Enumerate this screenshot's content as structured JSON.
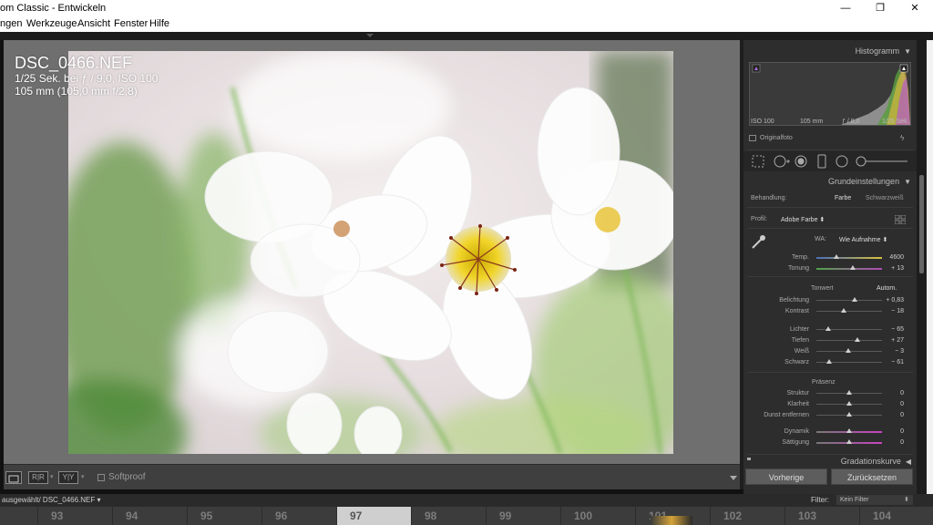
{
  "window": {
    "title": "om Classic - Entwickeln",
    "controls": {
      "minimize": "—",
      "maximize": "❐",
      "close": "✕"
    }
  },
  "menu": [
    "ngen",
    "Werkzeuge",
    "Ansicht",
    "Fenster",
    "Hilfe"
  ],
  "photo_info": {
    "filename": "DSC_0466.NEF",
    "exposure": "1/25 Sek. bei ƒ / 9,0, ISO 100",
    "lens": "105 mm (105,0 mm f/2,8)"
  },
  "toolbar": {
    "softproof_label": "Softproof",
    "xy_label": "Y|Y",
    "ab_label": "R|R"
  },
  "histogram": {
    "title": "Histogramm",
    "info": [
      "ISO 100",
      "105 mm",
      "ƒ / 9,0",
      "1/25 Sek."
    ],
    "original_label": "Originalfoto"
  },
  "basic": {
    "title": "Grundeinstellungen",
    "treatment_label": "Behandlung:",
    "treatment_options": [
      "Farbe",
      "Schwarzweiß"
    ],
    "profile_label": "Profil:",
    "profile_value": "Adobe Farbe ⬍",
    "wb_label": "WA:",
    "wb_value": "Wie Aufnahme ⬍",
    "tone_label": "Tonwert",
    "auto_label": "Autom.",
    "presence_label": "Präsenz",
    "sliders": [
      {
        "key": "temp",
        "label": "Temp.",
        "value": "4600",
        "pos": 0.3
      },
      {
        "key": "tint",
        "label": "Tonung",
        "value": "+ 13",
        "pos": 0.55
      },
      {
        "key": "exposure",
        "label": "Belichtung",
        "value": "+ 0,83",
        "pos": 0.58
      },
      {
        "key": "contrast",
        "label": "Kontrast",
        "value": "− 18",
        "pos": 0.41
      },
      {
        "key": "highlights",
        "label": "Lichter",
        "value": "− 65",
        "pos": 0.18
      },
      {
        "key": "shadows",
        "label": "Tiefen",
        "value": "+ 27",
        "pos": 0.63
      },
      {
        "key": "whites",
        "label": "Weiß",
        "value": "− 3",
        "pos": 0.48
      },
      {
        "key": "blacks",
        "label": "Schwarz",
        "value": "− 61",
        "pos": 0.19
      },
      {
        "key": "texture",
        "label": "Struktur",
        "value": "0",
        "pos": 0.5
      },
      {
        "key": "clarity",
        "label": "Klarheit",
        "value": "0",
        "pos": 0.5
      },
      {
        "key": "dehaze",
        "label": "Dunst entfernen",
        "value": "0",
        "pos": 0.5
      },
      {
        "key": "vibrance",
        "label": "Dynamik",
        "value": "0",
        "pos": 0.5
      },
      {
        "key": "saturation",
        "label": "Sättigung",
        "value": "0",
        "pos": 0.5
      }
    ]
  },
  "tone_curve": {
    "title": "Gradationskurve"
  },
  "buttons": {
    "previous": "Vorherige",
    "reset": "Zurücksetzen"
  },
  "status": {
    "path": "ausgewählt/ DSC_0466.NEF ▾",
    "filter_label": "Filter:",
    "filter_value": "Kein Filter"
  },
  "filmstrip": [
    "93",
    "94",
    "95",
    "96",
    "97",
    "98",
    "99",
    "100",
    "101",
    "102",
    "103",
    "104"
  ]
}
